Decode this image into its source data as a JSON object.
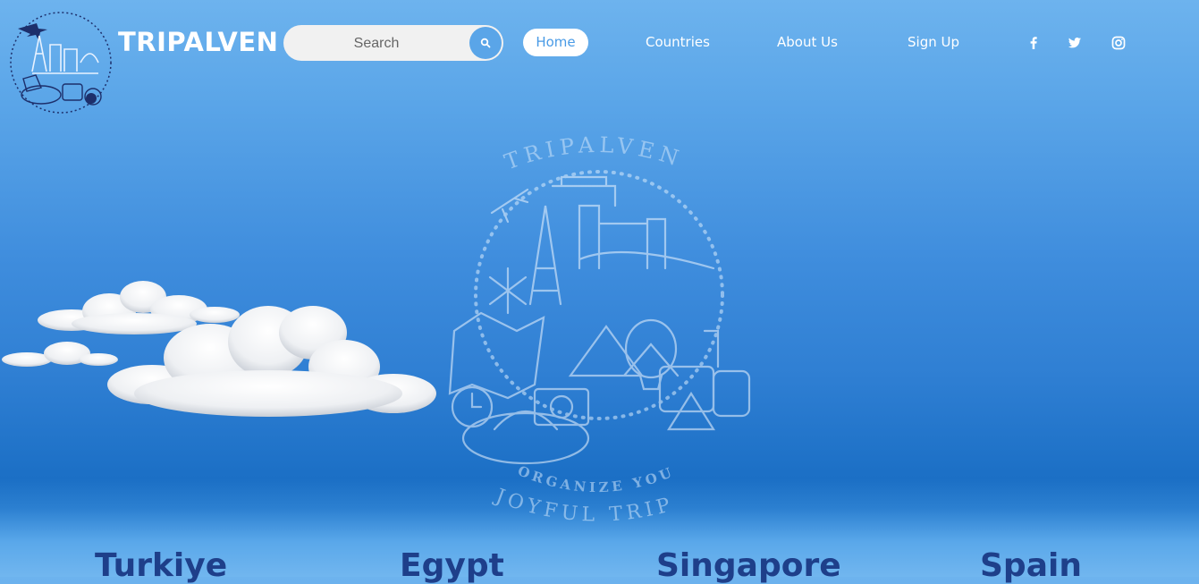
{
  "header": {
    "brand": "TRIPALVEN",
    "search": {
      "placeholder": "Search"
    },
    "nav": {
      "home": "Home",
      "countries": "Countries",
      "about": "About Us",
      "signup": "Sign Up"
    },
    "social_icons": [
      "facebook-icon",
      "twitter-icon",
      "instagram-icon"
    ]
  },
  "hero": {
    "emblem": {
      "top_text": "TRIPALVEN",
      "bottom_line1": "ORGANIZE YOUR",
      "bottom_line2": "JOYFUL TRIP"
    }
  },
  "countries": [
    "Turkiye",
    "Egypt",
    "Singapore",
    "Spain"
  ],
  "colors": {
    "sky_top": "#6db3ee",
    "sky_deep": "#1b6fc5",
    "home_text": "#4a9be6",
    "country_text": "#1e3f8a"
  }
}
